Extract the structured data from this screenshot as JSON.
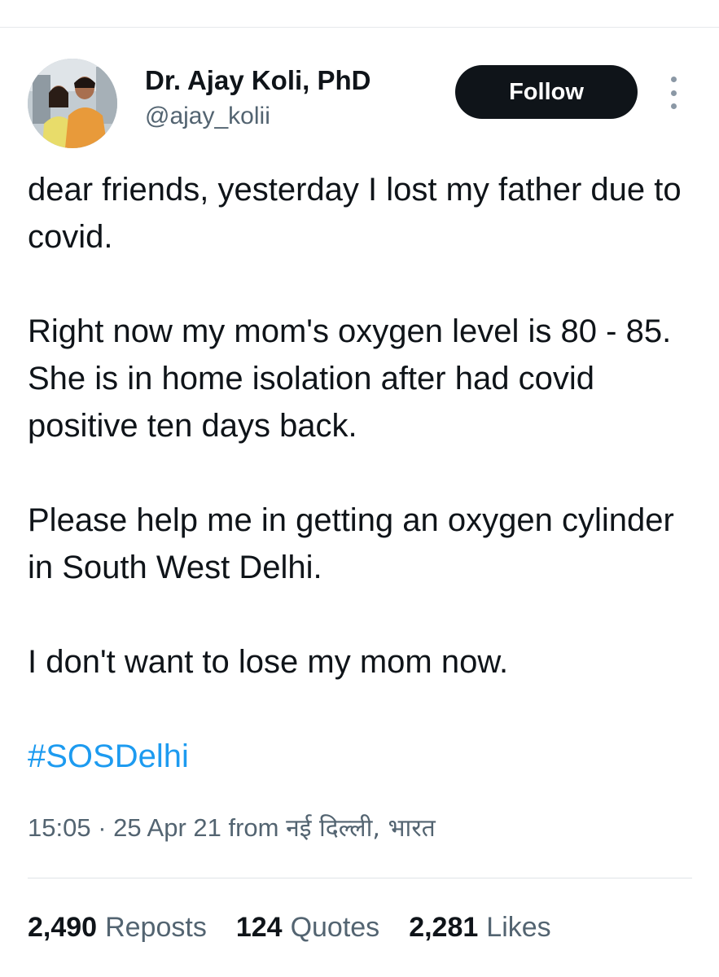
{
  "user": {
    "display_name": "Dr. Ajay Koli, PhD",
    "handle": "@ajay_kolii"
  },
  "follow_label": "Follow",
  "more_icon": "more-vertical-icon",
  "tweet": {
    "paragraphs": [
      "dear friends, yesterday I lost my father due to covid.",
      "Right now my mom's oxygen level is 80 - 85. She is in home isolation after had covid positive ten days back.",
      "Please help me in getting an oxygen cylinder in South West Delhi.",
      "I don't want to lose my mom now."
    ],
    "hashtag": "#SOSDelhi"
  },
  "meta": {
    "time": "15:05",
    "separator": "·",
    "date": "25 Apr 21",
    "from_label": "from",
    "location": "नई दिल्ली, भारत"
  },
  "stats": {
    "reposts_count": "2,490",
    "reposts_label": "Reposts",
    "quotes_count": "124",
    "quotes_label": "Quotes",
    "likes_count": "2,281",
    "likes_label": "Likes"
  },
  "colors": {
    "link": "#1d9bf0",
    "secondary_text": "#536471",
    "button_bg": "#0f1419"
  }
}
